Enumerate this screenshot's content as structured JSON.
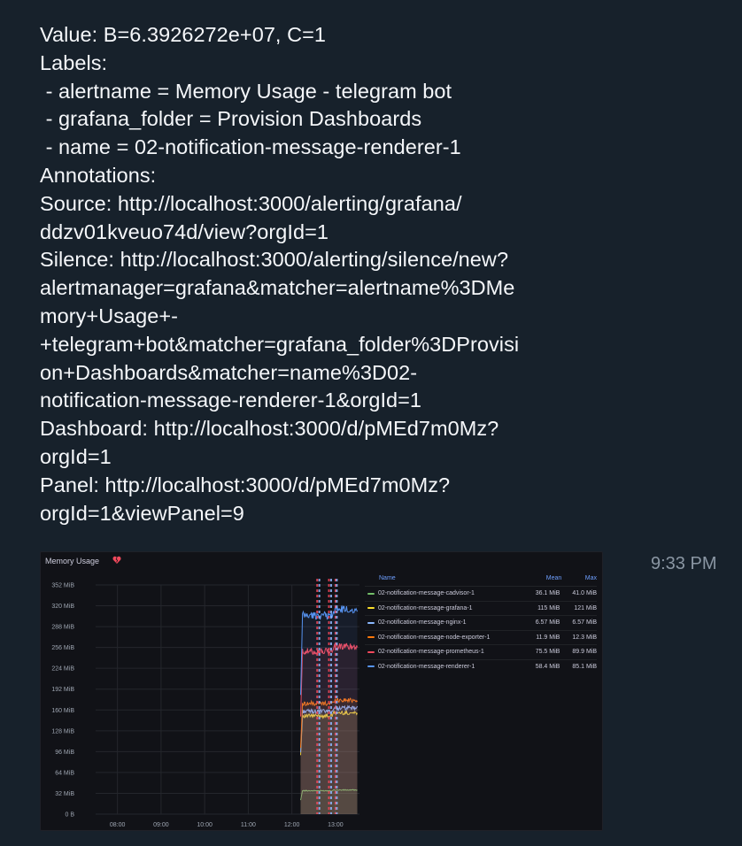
{
  "message": {
    "lines": [
      "Value: B=6.3926272e+07, C=1",
      "Labels:",
      " - alertname = Memory Usage - telegram bot",
      " - grafana_folder = Provision Dashboards",
      " - name = 02-notification-message-renderer-1",
      "Annotations:",
      "Source: http://localhost:3000/alerting/grafana/",
      "ddzv01kveuo74d/view?orgId=1",
      "Silence: http://localhost:3000/alerting/silence/new?",
      "alertmanager=grafana&matcher=alertname%3DMe",
      "mory+Usage+-",
      "+telegram+bot&matcher=grafana_folder%3DProvisi",
      "on+Dashboards&matcher=name%3D02-",
      "notification-message-renderer-1&orgId=1",
      "Dashboard: http://localhost:3000/d/pMEd7m0Mz?",
      "orgId=1",
      "Panel: http://localhost:3000/d/pMEd7m0Mz?",
      "orgId=1&viewPanel=9"
    ],
    "time": "9:33 PM"
  },
  "panel": {
    "title": "Memory Usage",
    "icon": "broken-heart-icon",
    "legend": {
      "headers": {
        "name": "Name",
        "mean": "Mean",
        "max": "Max"
      },
      "rows": [
        {
          "name": "02-notification-message-cadvisor-1",
          "mean": "36.1 MiB",
          "max": "41.0 MiB",
          "color": "#73bf69"
        },
        {
          "name": "02-notification-message-grafana-1",
          "mean": "115 MiB",
          "max": "121 MiB",
          "color": "#fade2a"
        },
        {
          "name": "02-notification-message-nginx-1",
          "mean": "6.57 MiB",
          "max": "6.57 MiB",
          "color": "#8ab8ff"
        },
        {
          "name": "02-notification-message-node-exporter-1",
          "mean": "11.9 MiB",
          "max": "12.3 MiB",
          "color": "#ff780a"
        },
        {
          "name": "02-notification-message-prometheus-1",
          "mean": "75.5 MiB",
          "max": "89.9 MiB",
          "color": "#f2495c"
        },
        {
          "name": "02-notification-message-renderer-1",
          "mean": "58.4 MiB",
          "max": "85.1 MiB",
          "color": "#5794f2"
        }
      ]
    }
  },
  "chart_data": {
    "type": "line",
    "y_ticks": [
      "352 MiB",
      "320 MiB",
      "288 MiB",
      "256 MiB",
      "224 MiB",
      "192 MiB",
      "160 MiB",
      "128 MiB",
      "96 MiB",
      "64 MiB",
      "32 MiB",
      "0 B"
    ],
    "x_ticks": [
      "08:00",
      "09:00",
      "10:00",
      "11:00",
      "12:00",
      "13:00"
    ],
    "ylim": [
      0,
      352
    ],
    "x_range_hours": [
      7.5,
      13.55
    ],
    "grid": true,
    "legend_position": "right",
    "stacked": true,
    "data_start_hour": 12.2,
    "alert_markers_hours": [
      12.58,
      12.63,
      12.85,
      12.9,
      13.0,
      13.03
    ],
    "series": [
      {
        "name": "02-notification-message-cadvisor-1",
        "color": "#73bf69",
        "level": 36
      },
      {
        "name": "02-notification-message-grafana-1",
        "color": "#fade2a",
        "level": 151
      },
      {
        "name": "02-notification-message-nginx-1",
        "color": "#8ab8ff",
        "level": 158
      },
      {
        "name": "02-notification-message-node-exporter-1",
        "color": "#ff780a",
        "level": 170
      },
      {
        "name": "02-notification-message-prometheus-1",
        "color": "#f2495c",
        "level": 250
      },
      {
        "name": "02-notification-message-renderer-1",
        "color": "#5794f2",
        "level": 305
      }
    ]
  }
}
